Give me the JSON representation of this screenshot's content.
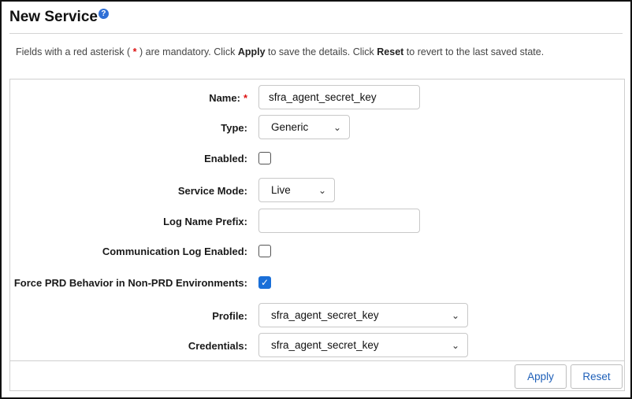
{
  "header": {
    "title": "New Service",
    "help_glyph": "?"
  },
  "instructions": {
    "part1": "Fields with a red asterisk (",
    "star": " * ",
    "part2": ") are mandatory. Click ",
    "apply": "Apply",
    "part3": " to save the details. Click ",
    "reset": "Reset",
    "part4": " to revert to the last saved state."
  },
  "form": {
    "name": {
      "label": "Name:",
      "required_mark": "*",
      "value": "sfra_agent_secret_key"
    },
    "type": {
      "label": "Type:",
      "selected": "Generic"
    },
    "enabled": {
      "label": "Enabled:",
      "checked": false
    },
    "service_mode": {
      "label": "Service Mode:",
      "selected": "Live"
    },
    "log_name_prefix": {
      "label": "Log Name Prefix:",
      "value": ""
    },
    "communication_log_enabled": {
      "label": "Communication Log Enabled:",
      "checked": false
    },
    "force_prd": {
      "label": "Force PRD Behavior in Non-PRD Environments:",
      "checked": true,
      "check_glyph": "✓"
    },
    "profile": {
      "label": "Profile:",
      "selected": "sfra_agent_secret_key"
    },
    "credentials": {
      "label": "Credentials:",
      "selected": "sfra_agent_secret_key"
    }
  },
  "buttons": {
    "apply": "Apply",
    "reset": "Reset"
  },
  "icons": {
    "chevron": "⌄"
  },
  "colors": {
    "required": "#dd1111",
    "accent": "#1a6fd8",
    "link": "#1e5fb8"
  }
}
